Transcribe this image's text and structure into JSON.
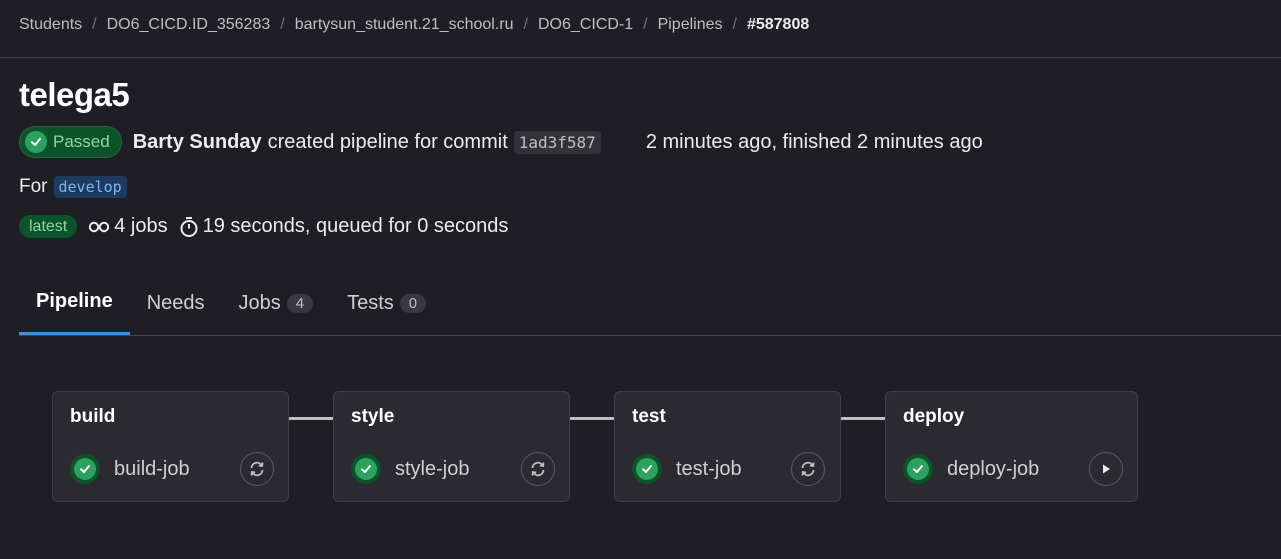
{
  "breadcrumb": [
    {
      "label": "Students"
    },
    {
      "label": "DO6_CICD.ID_356283"
    },
    {
      "label": "bartysun_student.21_school.ru"
    },
    {
      "label": "DO6_CICD-1"
    },
    {
      "label": "Pipelines"
    },
    {
      "label": "#587808"
    }
  ],
  "page": {
    "title": "telega5"
  },
  "pipeline": {
    "status": "Passed",
    "author": "Barty Sunday",
    "action_text": "created pipeline for commit",
    "commit": "1ad3f587",
    "time_info": "2 minutes ago, finished 2 minutes ago",
    "for_label": "For",
    "branch": "develop",
    "latest_badge": "latest",
    "jobs_count": "4 jobs",
    "duration": "19 seconds, queued for 0 seconds"
  },
  "tabs": [
    {
      "label": "Pipeline",
      "count": null
    },
    {
      "label": "Needs",
      "count": null
    },
    {
      "label": "Jobs",
      "count": "4"
    },
    {
      "label": "Tests",
      "count": "0"
    }
  ],
  "stages": [
    {
      "name": "build",
      "job": "build-job",
      "action": "retry-icon"
    },
    {
      "name": "style",
      "job": "style-job",
      "action": "retry-icon"
    },
    {
      "name": "test",
      "job": "test-job",
      "action": "retry-icon"
    },
    {
      "name": "deploy",
      "job": "deploy-job",
      "action": "play-icon"
    }
  ],
  "colors": {
    "background": "#1f1e24",
    "success": "#2da160",
    "accent_tab": "#428fdc"
  }
}
